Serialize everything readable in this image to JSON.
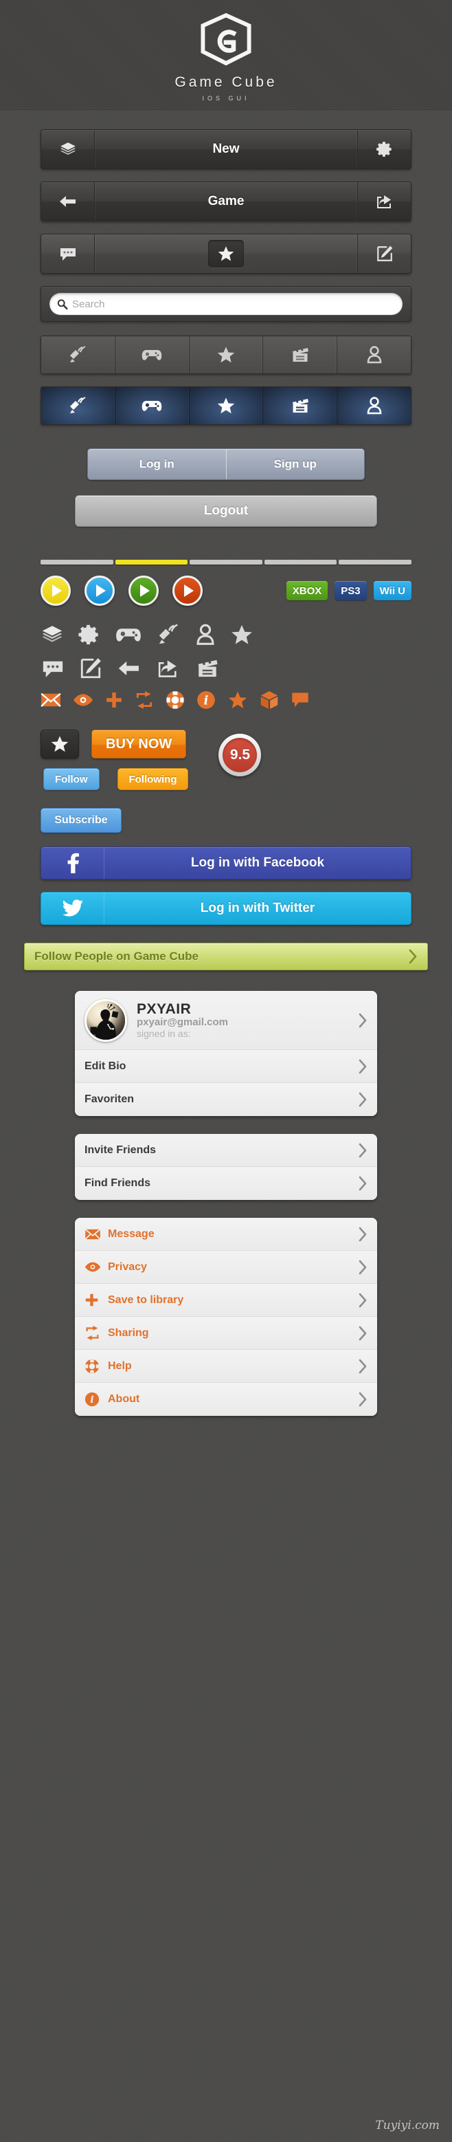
{
  "hero": {
    "logo_icon": "game-cube-hex-logo",
    "title": "Game Cube",
    "subtitle": "IOS GUI"
  },
  "navbars": [
    {
      "left_icon": "layers-icon",
      "title": "New",
      "right_icon": "gear-icon"
    },
    {
      "left_icon": "arrow-left-icon",
      "title": "Game",
      "right_icon": "share-icon"
    },
    {
      "left_icon": "comment-icon",
      "center_icon": "star-icon",
      "right_icon": "compose-icon"
    }
  ],
  "search": {
    "icon": "search-icon",
    "placeholder": "Search",
    "value": ""
  },
  "tabbars": {
    "inactive": [
      {
        "icon": "satellite-icon",
        "name": "radar"
      },
      {
        "icon": "gamepad-icon",
        "name": "games"
      },
      {
        "icon": "star-icon",
        "name": "favorites"
      },
      {
        "icon": "clapperboard-icon",
        "name": "videos"
      },
      {
        "icon": "user-icon",
        "name": "profile"
      }
    ],
    "active": [
      {
        "icon": "satellite-icon",
        "name": "radar"
      },
      {
        "icon": "gamepad-icon",
        "name": "games"
      },
      {
        "icon": "star-icon",
        "name": "favorites"
      },
      {
        "icon": "clapperboard-icon",
        "name": "videos"
      },
      {
        "icon": "user-icon",
        "name": "profile"
      }
    ]
  },
  "auth": {
    "login_label": "Log in",
    "signup_label": "Sign up",
    "logout_label": "Logout"
  },
  "progress": {
    "segments": 5,
    "active_index": 1,
    "active_color": "#f0e222",
    "track_color": "#c6c6c6"
  },
  "play_buttons": [
    {
      "name": "play-yellow",
      "color": "#f2dc1e"
    },
    {
      "name": "play-blue",
      "color": "#2aa7e8"
    },
    {
      "name": "play-green",
      "color": "#4a9c1e"
    },
    {
      "name": "play-red",
      "color": "#cf4512"
    }
  ],
  "platforms": [
    {
      "label": "XBOX",
      "color": "#57a41c"
    },
    {
      "label": "PS3",
      "color": "#2b4d86"
    },
    {
      "label": "Wii U",
      "color": "#2aa7e8"
    }
  ],
  "icon_rows": {
    "row1": [
      "layers-icon",
      "gear-icon",
      "gamepad-icon",
      "satellite-icon",
      "user-icon",
      "star-icon"
    ],
    "row2": [
      "comment-icon",
      "compose-icon",
      "arrow-left-icon",
      "share-icon",
      "clapperboard-icon"
    ],
    "row3": [
      "envelope-icon",
      "eye-icon",
      "plus-icon",
      "retweet-icon",
      "lifebuoy-icon",
      "info-icon",
      "star-icon",
      "box-icon",
      "speech-bubble-icon"
    ],
    "row3_color": "#e2712c"
  },
  "actions": {
    "star_icon": "star-icon",
    "buy_now_label": "BUY NOW",
    "rating_value": "9.5",
    "follow_label": "Follow",
    "following_label": "Following",
    "subscribe_label": "Subscribe"
  },
  "social": {
    "facebook": {
      "icon": "facebook-icon",
      "label": "Log in with Facebook",
      "color": "#3a46a0"
    },
    "twitter": {
      "icon": "twitter-icon",
      "label": "Log in with Twitter",
      "color": "#16a8da"
    }
  },
  "banner": {
    "label": "Follow People on Game Cube",
    "chevron_icon": "chevron-right-icon"
  },
  "profile": {
    "avatar_icon": "user-avatar-photo",
    "name": "PXYAIR",
    "email": "pxyair@gmail.com",
    "status": "signed in as:",
    "chevron_icon": "chevron-right-icon"
  },
  "lists": {
    "account": [
      {
        "label": "Edit Bio",
        "icon": null
      },
      {
        "label": "Favoriten",
        "icon": null
      }
    ],
    "friends": [
      {
        "label": "Invite Friends",
        "icon": null
      },
      {
        "label": "Find Friends",
        "icon": null
      }
    ],
    "settings": [
      {
        "label": "Message",
        "icon": "envelope-icon"
      },
      {
        "label": "Privacy",
        "icon": "eye-icon"
      },
      {
        "label": "Save to library",
        "icon": "plus-icon"
      },
      {
        "label": "Sharing",
        "icon": "retweet-icon"
      },
      {
        "label": "Help",
        "icon": "lifebuoy-icon"
      },
      {
        "label": "About",
        "icon": "info-icon"
      }
    ]
  },
  "footer": {
    "watermark": "Tuyiyi.com"
  }
}
